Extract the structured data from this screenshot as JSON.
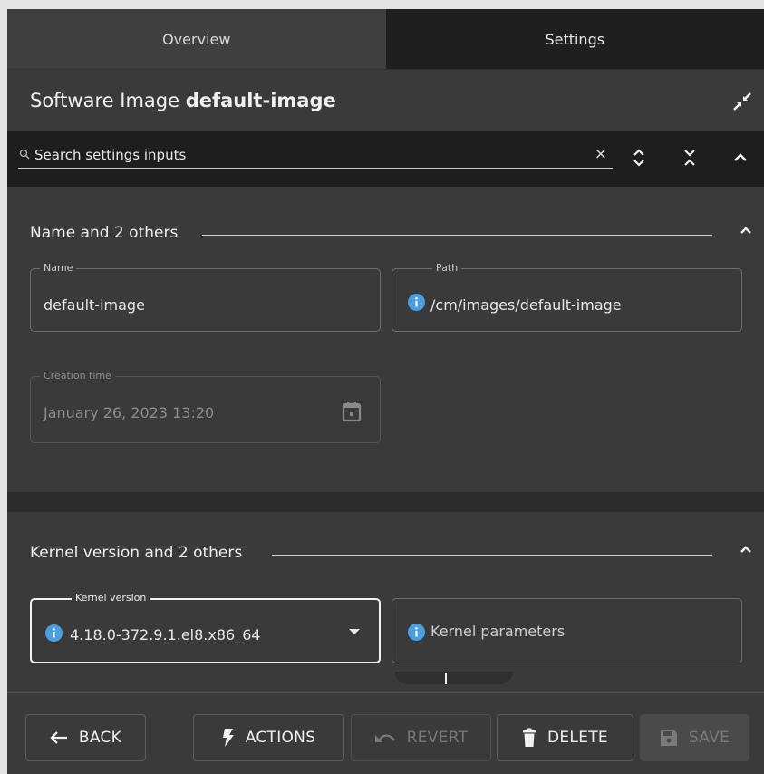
{
  "tabs": [
    {
      "label": "Overview"
    },
    {
      "label": "Settings"
    }
  ],
  "header": {
    "title_prefix": "Software Image ",
    "title_name": "default-image",
    "collapse_icon": "collapse-icon"
  },
  "search": {
    "placeholder": "Search settings inputs",
    "value": "",
    "clear_label": "×"
  },
  "sections": [
    {
      "title": "Name and 2 others",
      "fields": {
        "name": {
          "label": "Name",
          "value": "default-image"
        },
        "path": {
          "label": "Path",
          "value": "/cm/images/default-image"
        },
        "creation_time": {
          "label": "Creation time",
          "value": "January 26, 2023 13:20"
        }
      }
    },
    {
      "title": "Kernel version and 2 others",
      "fields": {
        "kernel_version": {
          "label": "Kernel version",
          "value": "4.18.0-372.9.1.el8.x86_64"
        },
        "kernel_parameters": {
          "label": "Kernel parameters",
          "value": ""
        }
      }
    }
  ],
  "footer": {
    "back": "BACK",
    "actions": "ACTIONS",
    "revert": "REVERT",
    "delete": "DELETE",
    "save": "SAVE"
  },
  "colors": {
    "background": "#3a3a3a",
    "dark_bar": "#1e1e1e",
    "info_blue": "#4a9fe0",
    "text": "#e8e8e8"
  }
}
